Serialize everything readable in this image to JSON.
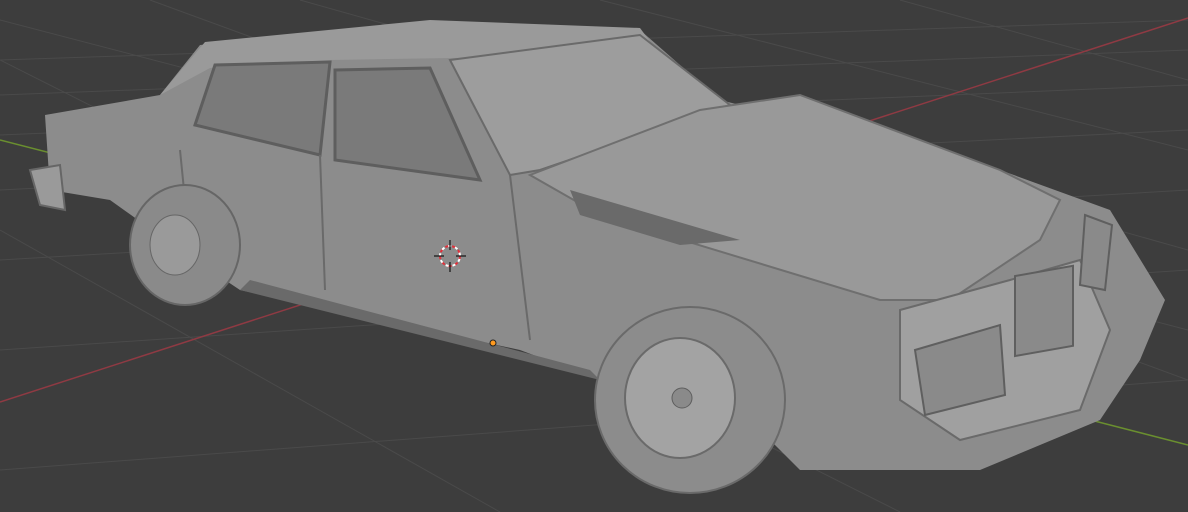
{
  "viewport": {
    "name": "3D Viewport",
    "object": "car-model",
    "colors": {
      "background": "#3d3d3d",
      "grid": "#4a4a4a",
      "x_axis": "#8f3a43",
      "y_axis": "#6a8f2f",
      "mesh": "#8c8c8c",
      "mesh_dark": "#6a6a6a",
      "mesh_light": "#a6a6a6",
      "origin": "#ff9a1f",
      "cursor_red": "#e0303a"
    }
  }
}
